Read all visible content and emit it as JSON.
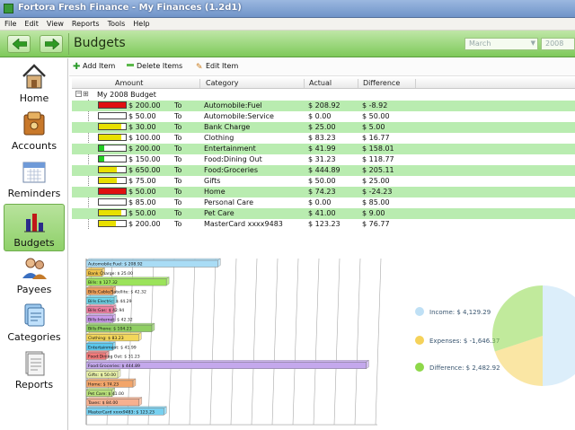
{
  "window": {
    "title": "Fortora Fresh Finance - My Finances (1.2d1)"
  },
  "menu": [
    "File",
    "Edit",
    "View",
    "Reports",
    "Tools",
    "Help"
  ],
  "nav": {
    "back_icon": "left-arrow-icon",
    "forward_icon": "right-arrow-icon",
    "page_title": "Budgets",
    "month_value": "March",
    "year_value": "2008"
  },
  "sidebar": {
    "items": [
      {
        "label": "Home",
        "icon": "home-icon"
      },
      {
        "label": "Accounts",
        "icon": "accounts-icon"
      },
      {
        "label": "Reminders",
        "icon": "calendar-icon"
      },
      {
        "label": "Budgets",
        "icon": "budget-chart-icon",
        "active": true
      },
      {
        "label": "Payees",
        "icon": "payees-icon"
      },
      {
        "label": "Categories",
        "icon": "categories-icon"
      },
      {
        "label": "Reports",
        "icon": "reports-icon"
      }
    ]
  },
  "toolbar": {
    "add_label": "Add Item",
    "delete_label": "Delete Items",
    "edit_label": "Edit Item"
  },
  "table": {
    "columns": [
      "Amount",
      "Category",
      "Actual",
      "Difference"
    ],
    "root_label": "My 2008 Budget",
    "rows": [
      {
        "amount": "$ 200.00",
        "to": "To",
        "category": "Automobile:Fuel",
        "actual": "$ 208.92",
        "difference": "$ -8.92",
        "progress": 1.04,
        "bar_color": "#e01010"
      },
      {
        "amount": "$ 50.00",
        "to": "To",
        "category": "Automobile:Service",
        "actual": "$ 0.00",
        "difference": "$ 50.00",
        "progress": 0,
        "bar_color": "#e8e000"
      },
      {
        "amount": "$ 30.00",
        "to": "To",
        "category": "Bank Charge",
        "actual": "$ 25.00",
        "difference": "$ 5.00",
        "progress": 0.83,
        "bar_color": "#e8e000"
      },
      {
        "amount": "$ 100.00",
        "to": "To",
        "category": "Clothing",
        "actual": "$ 83.23",
        "difference": "$ 16.77",
        "progress": 0.83,
        "bar_color": "#e8e000"
      },
      {
        "amount": "$ 200.00",
        "to": "To",
        "category": "Entertainment",
        "actual": "$ 41.99",
        "difference": "$ 158.01",
        "progress": 0.21,
        "bar_color": "#22cc22"
      },
      {
        "amount": "$ 150.00",
        "to": "To",
        "category": "Food:Dining Out",
        "actual": "$ 31.23",
        "difference": "$ 118.77",
        "progress": 0.21,
        "bar_color": "#22cc22"
      },
      {
        "amount": "$ 650.00",
        "to": "To",
        "category": "Food:Groceries",
        "actual": "$ 444.89",
        "difference": "$ 205.11",
        "progress": 0.68,
        "bar_color": "#e8e000"
      },
      {
        "amount": "$ 75.00",
        "to": "To",
        "category": "Gifts",
        "actual": "$ 50.00",
        "difference": "$ 25.00",
        "progress": 0.67,
        "bar_color": "#e8e000"
      },
      {
        "amount": "$ 50.00",
        "to": "To",
        "category": "Home",
        "actual": "$ 74.23",
        "difference": "$ -24.23",
        "progress": 1.48,
        "bar_color": "#e01010"
      },
      {
        "amount": "$ 85.00",
        "to": "To",
        "category": "Personal Care",
        "actual": "$ 0.00",
        "difference": "$ 85.00",
        "progress": 0,
        "bar_color": "#e8e000"
      },
      {
        "amount": "$ 50.00",
        "to": "To",
        "category": "Pet Care",
        "actual": "$ 41.00",
        "difference": "$ 9.00",
        "progress": 0.82,
        "bar_color": "#e8e000"
      },
      {
        "amount": "$ 200.00",
        "to": "To",
        "category": "MasterCard xxxx9483",
        "actual": "$ 123.23",
        "difference": "$ 76.77",
        "progress": 0.62,
        "bar_color": "#e8e000"
      }
    ]
  },
  "chart_data": [
    {
      "type": "bar",
      "orientation": "horizontal",
      "categories": [
        "Automobile:Fuel",
        "Bank Charge",
        "Bills",
        "Bills:Cable/Satellite",
        "Bills:Electric",
        "Bills:Gas",
        "Bills:Internet",
        "Bills:Phone",
        "Clothing",
        "Entertainment",
        "Food:Dining Out",
        "Food:Groceries",
        "Gifts",
        "Home",
        "Pet Care",
        "Taxes",
        "MasterCard xxxx9483"
      ],
      "values": [
        208.92,
        25.0,
        127.32,
        42.32,
        44.29,
        42.94,
        42.32,
        104.23,
        83.23,
        41.99,
        31.23,
        444.89,
        50.0,
        74.23,
        41.0,
        84.0,
        123.23
      ],
      "labels": [
        "Automobile:Fuel: $ 208.92",
        "Bank Charge: $ 25.00",
        "Bills: $ 127.32",
        "Bills:Cable/Satellite: $ 42.32",
        "Bills:Electric: $ 44.29",
        "Bills:Gas: $ 42.94",
        "Bills:Internet: $ 42.32",
        "Bills:Phone: $ 104.23",
        "Clothing: $ 83.23",
        "Entertainment: $ 41.99",
        "Food:Dining Out: $ 31.23",
        "Food:Groceries: $ 444.89",
        "Gifts: $ 50.00",
        "Home: $ 74.23",
        "Pet Care: $ 41.00",
        "Taxes: $ 84.00",
        "MasterCard xxxx9483: $ 123.23"
      ],
      "colors": [
        "#a9dcf5",
        "#f2c44a",
        "#9be35a",
        "#f0a15a",
        "#6fd6ea",
        "#ec7fa0",
        "#c79ae8",
        "#8fcf62",
        "#f3d65a",
        "#5ac6ec",
        "#f27a7a",
        "#c4a8ec",
        "#e8f0a8",
        "#f2a56a",
        "#b8e07a",
        "#f7b08f",
        "#78d0f0"
      ],
      "xlim": [
        0,
        460
      ],
      "grid": true,
      "style": "3d-bars"
    },
    {
      "type": "pie",
      "labels": [
        "Income: $ 4,129.29",
        "Expenses: $ -1,646.37",
        "Difference: $ 2,482.92"
      ],
      "values": [
        4129.29,
        1646.37,
        2482.92
      ],
      "colors": [
        "#bfe0f5",
        "#f5d25a",
        "#8ed84a"
      ],
      "legend": "left"
    }
  ]
}
